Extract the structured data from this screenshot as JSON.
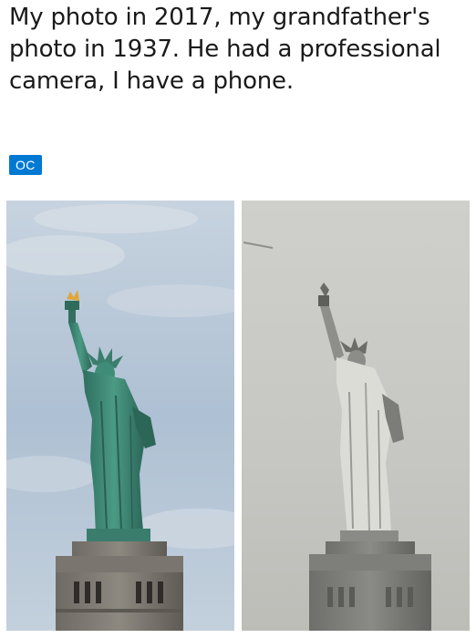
{
  "post": {
    "title": "My photo in 2017, my grandfather's photo in 1937. He had a professional camera, I have a phone.",
    "flair": "OC"
  },
  "colors": {
    "flair_bg": "#0079d3",
    "title_text": "#1a1a1b",
    "sky": "#b6c6d6",
    "statue_copper": "#3f8c79",
    "pedestal": "#7b7770",
    "old_photo_bg": "#c9c9c5"
  },
  "photos": {
    "left": {
      "kind": "color-photo",
      "subject": "statue"
    },
    "right": {
      "kind": "black-and-white-photo",
      "subject": "statue"
    }
  }
}
